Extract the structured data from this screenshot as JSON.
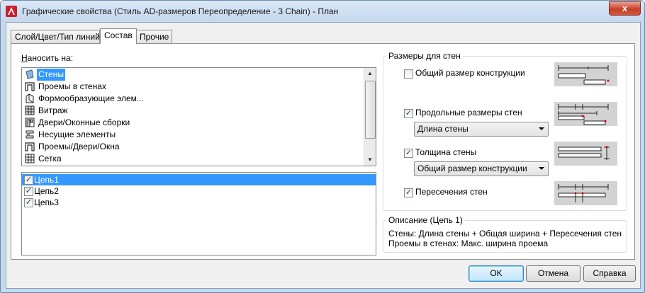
{
  "window": {
    "title": "Графические свойства (Стиль AD-размеров Переопределение - 3 Chain) - План",
    "close_label": "x"
  },
  "tabs": [
    {
      "label": "Слой/Цвет/Тип линий",
      "active": false
    },
    {
      "label": "Состав",
      "active": true
    },
    {
      "label": "Прочие",
      "active": false
    }
  ],
  "apply_to": {
    "label": "Наносить на:",
    "items": [
      {
        "label": "Стены",
        "icon": "wall-icon",
        "selected": true
      },
      {
        "label": "Проемы в стенах",
        "icon": "wall-opening-icon",
        "selected": false
      },
      {
        "label": "Формообразующие элем...",
        "icon": "mass-element-icon",
        "selected": false
      },
      {
        "label": "Витраж",
        "icon": "curtain-wall-icon",
        "selected": false
      },
      {
        "label": "Двери/Оконные сборки",
        "icon": "door-window-assembly-icon",
        "selected": false
      },
      {
        "label": "Несущие элементы",
        "icon": "structural-member-icon",
        "selected": false
      },
      {
        "label": "Проемы/Двери/Окна",
        "icon": "openings-doors-windows-icon",
        "selected": false
      },
      {
        "label": "Сетка",
        "icon": "grid-icon",
        "selected": false
      }
    ]
  },
  "chains": [
    {
      "label": "Цепь1",
      "checked": true,
      "selected": true
    },
    {
      "label": "Цепь2",
      "checked": true,
      "selected": false
    },
    {
      "label": "Цепь3",
      "checked": true,
      "selected": false
    }
  ],
  "wall_dims": {
    "legend": "Размеры для стен",
    "overall": {
      "label": "Общий размер конструкции",
      "checked": false
    },
    "length": {
      "label": "Продольные размеры стен",
      "checked": true,
      "select_value": "Длина стены"
    },
    "width": {
      "label": "Толщина стены",
      "checked": true,
      "select_value": "Общий размер конструкции"
    },
    "intersections": {
      "label": "Пересечения стен",
      "checked": true
    }
  },
  "description": {
    "legend": "Описание (Цепь 1)",
    "line1": "Стены: Длина стены + Общая ширина + Пересечения стен",
    "line2": "Проемы в стенах: Макс. ширина проема"
  },
  "buttons": {
    "ok": "OK",
    "cancel": "Отмена",
    "help": "Справка"
  },
  "colors": {
    "selection": "#3399ff",
    "app_icon": "#c8202b",
    "close_button": "#c7402a"
  }
}
